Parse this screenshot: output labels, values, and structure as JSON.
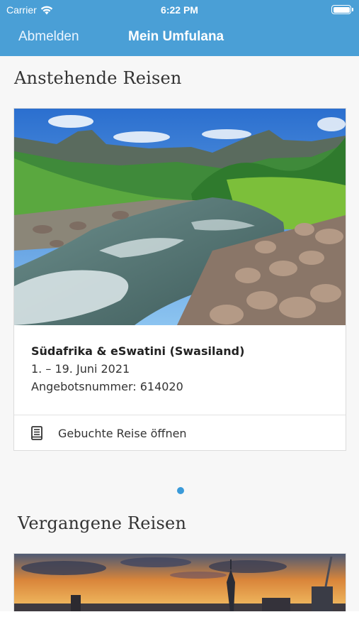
{
  "status_bar": {
    "carrier": "Carrier",
    "time": "6:22 PM",
    "icons": [
      "wifi-icon",
      "battery-icon"
    ]
  },
  "nav": {
    "logout_label": "Abmelden",
    "title": "Mein Umfulana"
  },
  "upcoming": {
    "heading": "Anstehende Reisen",
    "trip": {
      "image": "drakensberg-river-photo",
      "name": "Südafrika & eSwatini (Swasiland)",
      "dates": "1. – 19. Juni 2021",
      "offer_number": "Angebotsnummer: 614020",
      "open_label": "Gebuchte Reise öffnen",
      "open_icon": "book-icon"
    },
    "page_indicator": {
      "current": 1,
      "total": 1
    }
  },
  "past": {
    "heading": "Vergangene Reisen",
    "trip": {
      "image": "city-skyline-sunset-photo"
    }
  },
  "colors": {
    "header": "#4a9fd6",
    "background": "#f7f7f7",
    "accent_dot": "#3a9ad9"
  }
}
